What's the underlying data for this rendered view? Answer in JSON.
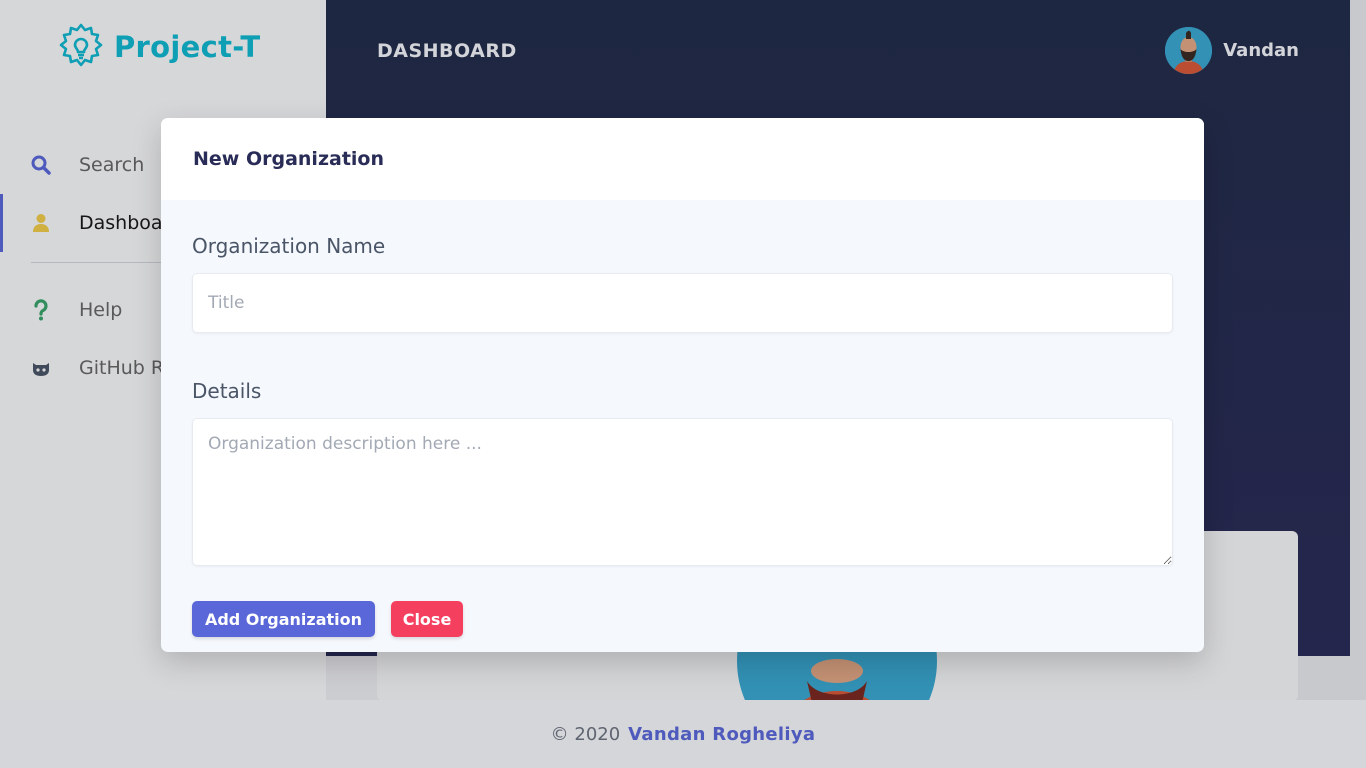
{
  "app": {
    "logo_text": "Project-T",
    "brand_color": "#11b5cf",
    "accent_color": "#5a67d8"
  },
  "sidebar": {
    "items": [
      {
        "label": "Search",
        "icon": "search-icon",
        "active": false
      },
      {
        "label": "Dashboard",
        "icon": "user-icon",
        "active": true
      },
      {
        "label": "Help",
        "icon": "question-icon",
        "active": false
      },
      {
        "label": "GitHub Repo",
        "icon": "github-icon",
        "active": false
      }
    ]
  },
  "header": {
    "title": "DASHBOARD",
    "user_name": "Vandan"
  },
  "modal": {
    "title": "New Organization",
    "name_label": "Organization Name",
    "name_placeholder": "Title",
    "details_label": "Details",
    "details_placeholder": "Organization description here ...",
    "add_button": "Add Organization",
    "close_button": "Close",
    "add_color": "#5a67d8",
    "close_color": "#f43f5e"
  },
  "footer": {
    "copyright": "© 2020",
    "author": "Vandan Rogheliya"
  }
}
